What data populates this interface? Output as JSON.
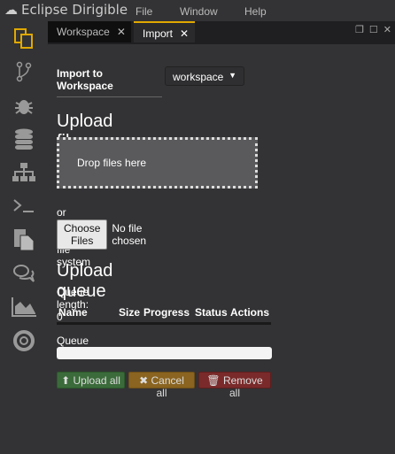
{
  "app": {
    "title": "Eclipse Dirigible"
  },
  "menu": [
    "File",
    "Window",
    "Help"
  ],
  "sidebar": [
    "workspace-icon",
    "git-icon",
    "debug-icon",
    "database-icon",
    "hierarchy-icon",
    "terminal-icon",
    "documents-icon",
    "chat-icon",
    "chart-icon",
    "help-icon"
  ],
  "tabs": [
    {
      "label": "Workspace",
      "active": false
    },
    {
      "label": "Import",
      "active": true
    }
  ],
  "import": {
    "label": "Import to Workspace",
    "workspace": "workspace"
  },
  "upload": {
    "title": "Upload files",
    "drop": "Drop files here",
    "browse": "or browse your file system",
    "choose": "Choose Files",
    "no_file": "No file chosen"
  },
  "queue": {
    "title": "Upload queue",
    "length": "Queue length: 0",
    "columns": [
      "Name",
      "Size",
      "Progress",
      "Status",
      "Actions"
    ],
    "progress_label": "Queue progress:",
    "progress": 0,
    "buttons": {
      "upload": "Upload all",
      "cancel": "Cancel all",
      "remove": "Remove all"
    }
  },
  "colors": {
    "accent": "#e0a800",
    "upload": "#3b6b3a",
    "cancel": "#8a6420",
    "remove": "#7a2a2a"
  }
}
